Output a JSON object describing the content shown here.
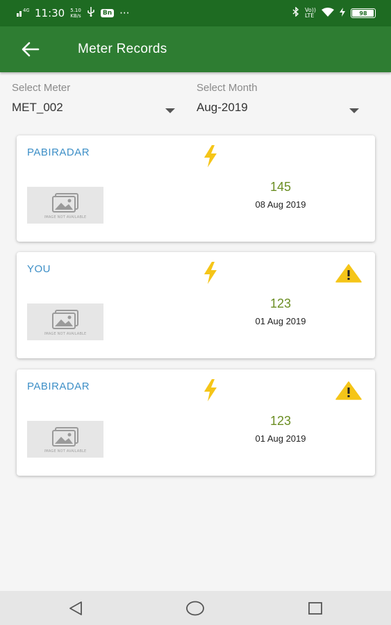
{
  "status_bar": {
    "time": "11:30",
    "speed_top": "5.10",
    "speed_bottom": "KB/s",
    "badge": "Bn",
    "dots": "···",
    "volte_top": "Vo))",
    "volte_bottom": "LTE",
    "battery_level": "98",
    "battery_fraction": 0.98
  },
  "app_bar": {
    "title": "Meter Records",
    "back_icon": "arrow-left-icon"
  },
  "filters": {
    "meter": {
      "label": "Select Meter",
      "value": "MET_002"
    },
    "month": {
      "label": "Select Month",
      "value": "Aug-2019"
    }
  },
  "records": [
    {
      "name": "PABIRADAR",
      "reading": "145",
      "date": "08 Aug 2019",
      "warning": false,
      "image_text": "IMAGE NOT AVAILABLE"
    },
    {
      "name": "YOU",
      "reading": "123",
      "date": "01 Aug 2019",
      "warning": true,
      "image_text": "IMAGE NOT AVAILABLE"
    },
    {
      "name": "PABIRADAR",
      "reading": "123",
      "date": "01 Aug 2019",
      "warning": true,
      "image_text": "IMAGE NOT AVAILABLE"
    }
  ],
  "colors": {
    "status_bar": "#1e6b22",
    "app_bar": "#2e7d32",
    "name_text": "#3d8fc7",
    "reading_text": "#6b8e23",
    "bolt": "#f5c518",
    "warning": "#f5c518"
  },
  "nav": {
    "back_icon": "triangle-back-icon",
    "home_icon": "circle-home-icon",
    "recents_icon": "square-recents-icon"
  }
}
